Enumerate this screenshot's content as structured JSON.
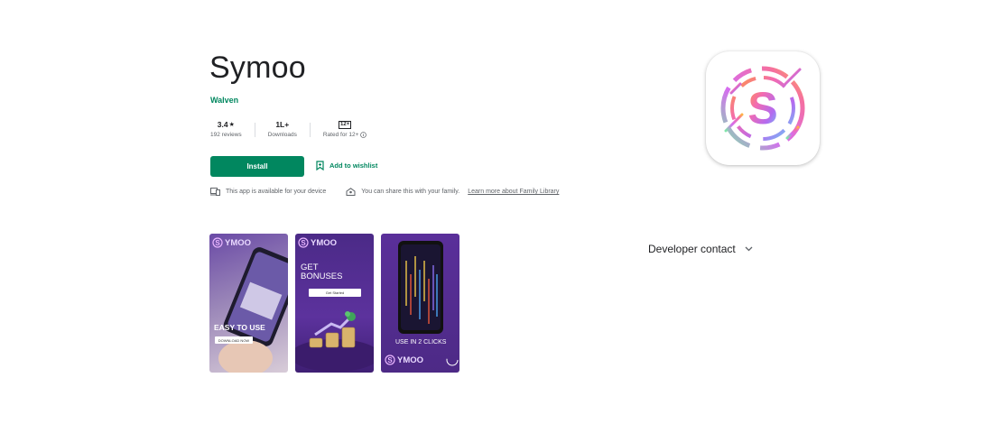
{
  "app": {
    "title": "Symoo",
    "developer": "Walven"
  },
  "stats": {
    "rating_value": "3.4",
    "rating_star": "★",
    "reviews_label": "192 reviews",
    "downloads_value": "1L+",
    "downloads_label": "Downloads",
    "age_badge": "12+",
    "age_label": "Rated for 12+"
  },
  "actions": {
    "install_label": "Install",
    "wishlist_label": "Add to wishlist"
  },
  "notes": {
    "device_text": "This app is available for your device",
    "family_text": "You can share this with your family.",
    "family_link": "Learn more about Family Library"
  },
  "screenshots": {
    "s1_brand": "YMOO",
    "s1_headline": "EASY TO USE",
    "s1_button": "DOWNLOAD NOW",
    "s2_brand": "YMOO",
    "s2_headline_1": "GET",
    "s2_headline_2": "BONUSES",
    "s2_button": "Get Started",
    "s3_caption": "USE IN 2 CLICKS",
    "s3_brand": "YMOO"
  },
  "sidebar": {
    "developer_contact": "Developer contact"
  },
  "colors": {
    "accent_green": "#01875f",
    "shot_purple": "#4b2a87"
  },
  "icons": [
    "star-icon",
    "info-icon",
    "bookmark-add-icon",
    "device-icon",
    "family-icon",
    "chevron-down-icon"
  ]
}
